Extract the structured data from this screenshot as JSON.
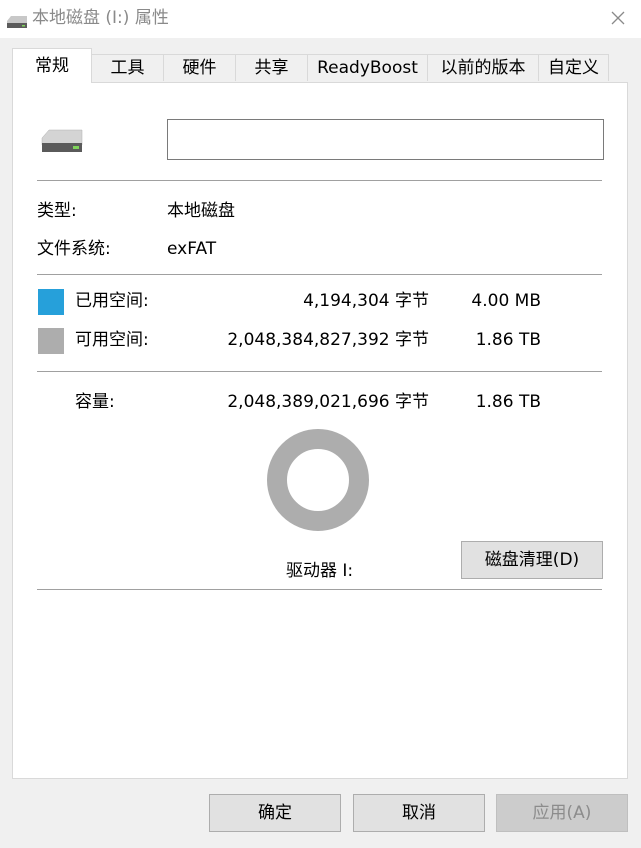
{
  "window": {
    "title": "本地磁盘 (I:) 属性"
  },
  "tabs": [
    {
      "label": "常规"
    },
    {
      "label": "工具"
    },
    {
      "label": "硬件"
    },
    {
      "label": "共享"
    },
    {
      "label": "ReadyBoost"
    },
    {
      "label": "以前的版本"
    },
    {
      "label": "自定义"
    }
  ],
  "general": {
    "name_value": "",
    "type_label": "类型:",
    "type_value": "本地磁盘",
    "fs_label": "文件系统:",
    "fs_value": "exFAT",
    "used": {
      "label": "已用空间:",
      "bytes": "4,194,304 字节",
      "size": "4.00 MB",
      "color": "#26a0da"
    },
    "free": {
      "label": "可用空间:",
      "bytes": "2,048,384,827,392 字节",
      "size": "1.86 TB",
      "color": "#adadad"
    },
    "capacity": {
      "label": "容量:",
      "bytes": "2,048,389,021,696 字节",
      "size": "1.86 TB"
    },
    "drive_label": "驱动器 I:",
    "cleanup_button": "磁盘清理(D)",
    "usage_fraction": 2e-06
  },
  "footer": {
    "ok": "确定",
    "cancel": "取消",
    "apply": "应用(A)"
  },
  "icons": [
    "drive-icon",
    "close-icon"
  ]
}
